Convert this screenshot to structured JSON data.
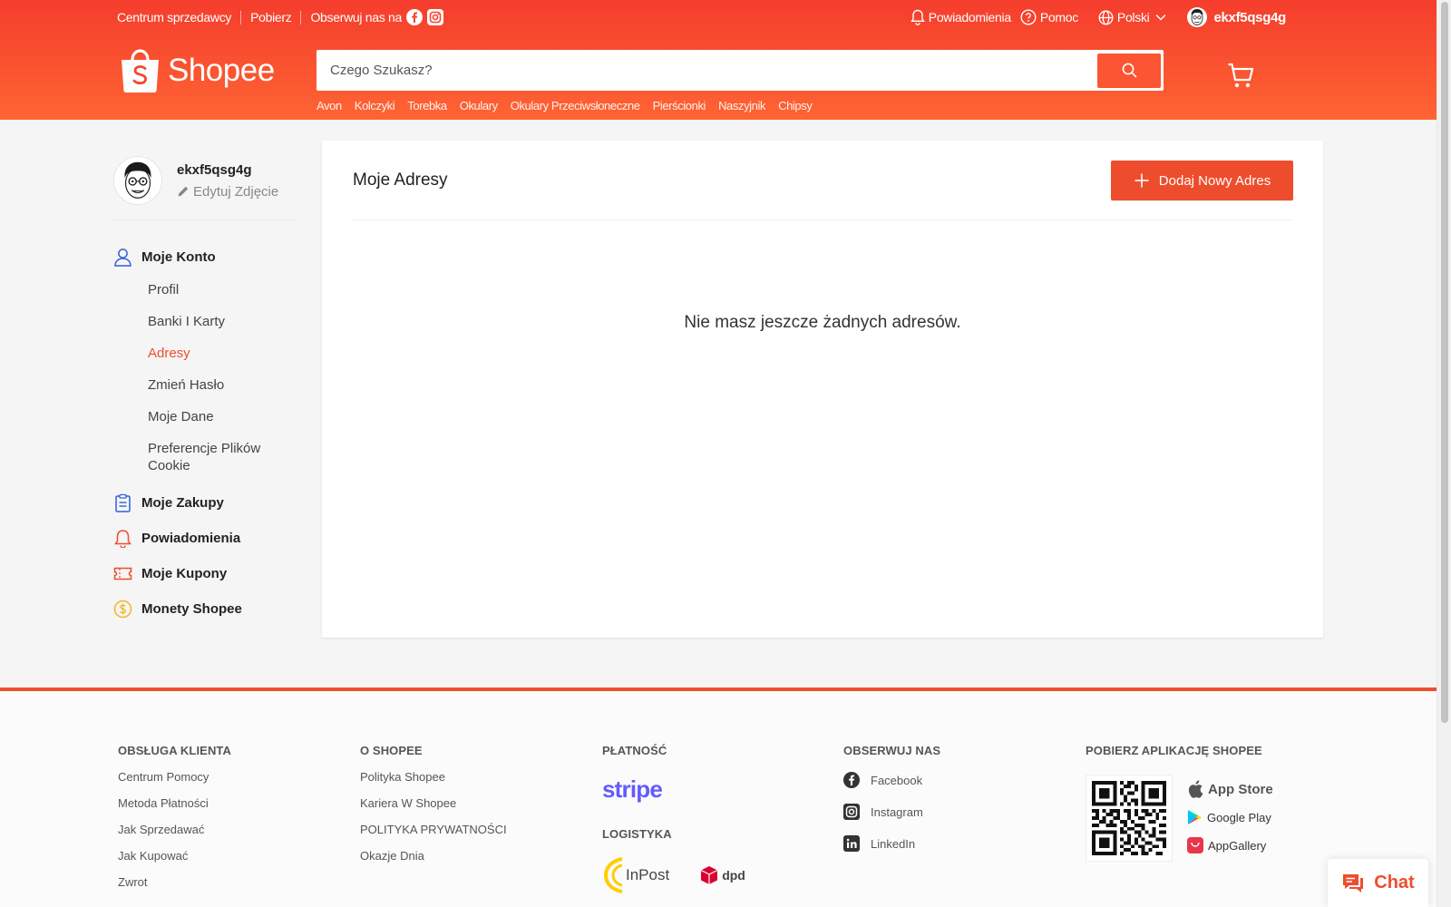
{
  "colors": {
    "brand": "#ee4d2d",
    "header_start": "#f53d2d",
    "header_end": "#fe6433"
  },
  "topbar": {
    "seller_center": "Centrum sprzedawcy",
    "download": "Pobierz",
    "follow_us": "Obserwuj nas na",
    "notifications": "Powiadomienia",
    "help": "Pomoc",
    "language": "Polski",
    "username": "ekxf5qsg4g"
  },
  "logo": {
    "text": "Shopee"
  },
  "search": {
    "placeholder": "Czego Szukasz?",
    "suggestions": [
      "Avon",
      "Kolczyki",
      "Torebka",
      "Okulary",
      "Okulary Przeciwsłoneczne",
      "Pierścionki",
      "Naszyjnik",
      "Chipsy"
    ]
  },
  "sidebar": {
    "username": "ekxf5qsg4g",
    "edit_photo": "Edytuj Zdjęcie",
    "account": "Moje Konto",
    "account_items": [
      "Profil",
      "Banki I Karty",
      "Adresy",
      "Zmień Hasło",
      "Moje Dane",
      "Preferencje Plików Cookie"
    ],
    "active_item": "Adresy",
    "purchases": "Moje Zakupy",
    "notifications": "Powiadomienia",
    "coupons": "Moje Kupony",
    "coins": "Monety Shopee"
  },
  "main": {
    "title": "Moje Adresy",
    "add_button": "Dodaj Nowy Adres",
    "empty_message": "Nie masz jeszcze żadnych adresów."
  },
  "footer": {
    "customer_service": {
      "heading": "OBSŁUGA KLIENTA",
      "links": [
        "Centrum Pomocy",
        "Metoda Płatności",
        "Jak Sprzedawać",
        "Jak Kupować",
        "Zwrot"
      ]
    },
    "about": {
      "heading": "O SHOPEE",
      "links": [
        "Polityka Shopee",
        "Kariera W Shopee",
        "POLITYKA PRYWATNOŚCI",
        "Okazje Dnia"
      ]
    },
    "payment": {
      "heading": "PŁATNOŚĆ",
      "provider": "stripe"
    },
    "logistics": {
      "heading": "LOGISTYKA",
      "carriers": [
        "InPost",
        "dpd"
      ]
    },
    "follow": {
      "heading": "OBSERWUJ NAS",
      "links": [
        "Facebook",
        "Instagram",
        "LinkedIn"
      ]
    },
    "app": {
      "heading": "POBIERZ APLIKACJĘ SHOPEE",
      "stores": [
        "App Store",
        "Google Play",
        "AppGallery"
      ]
    }
  },
  "chat": {
    "label": "Chat"
  }
}
